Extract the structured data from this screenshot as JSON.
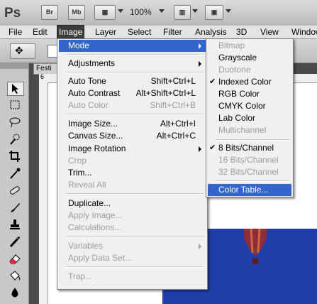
{
  "app": {
    "logo": "Ps",
    "bridge_button": "Br",
    "minibridge_button": "Mb",
    "zoom": "100%"
  },
  "menubar": [
    "File",
    "Edit",
    "Image",
    "Layer",
    "Select",
    "Filter",
    "Analysis",
    "3D",
    "View",
    "Window"
  ],
  "document": {
    "tab_title": "Festi",
    "ruler_mark": "6",
    "ruler_mark_top": "1"
  },
  "image_menu": {
    "items": [
      {
        "label": "Mode",
        "shortcut": "",
        "submenu": true,
        "disabled": false,
        "highlight": true
      },
      {
        "label": "Adjustments",
        "shortcut": "",
        "submenu": true,
        "disabled": false
      },
      {
        "label": "Auto Tone",
        "shortcut": "Shift+Ctrl+L",
        "disabled": false
      },
      {
        "label": "Auto Contrast",
        "shortcut": "Alt+Shift+Ctrl+L",
        "disabled": false
      },
      {
        "label": "Auto Color",
        "shortcut": "Shift+Ctrl+B",
        "disabled": true
      },
      {
        "label": "Image Size...",
        "shortcut": "Alt+Ctrl+I",
        "disabled": false
      },
      {
        "label": "Canvas Size...",
        "shortcut": "Alt+Ctrl+C",
        "disabled": false
      },
      {
        "label": "Image Rotation",
        "shortcut": "",
        "submenu": true,
        "disabled": false
      },
      {
        "label": "Crop",
        "shortcut": "",
        "disabled": true
      },
      {
        "label": "Trim...",
        "shortcut": "",
        "disabled": false
      },
      {
        "label": "Reveal All",
        "shortcut": "",
        "disabled": true
      },
      {
        "label": "Duplicate...",
        "shortcut": "",
        "disabled": false
      },
      {
        "label": "Apply Image...",
        "shortcut": "",
        "disabled": true
      },
      {
        "label": "Calculations...",
        "shortcut": "",
        "disabled": true
      },
      {
        "label": "Variables",
        "shortcut": "",
        "submenu": true,
        "disabled": true
      },
      {
        "label": "Apply Data Set...",
        "shortcut": "",
        "disabled": true
      },
      {
        "label": "Trap...",
        "shortcut": "",
        "disabled": true
      }
    ]
  },
  "mode_menu": {
    "items": [
      {
        "label": "Bitmap",
        "disabled": true,
        "checked": false
      },
      {
        "label": "Grayscale",
        "disabled": false,
        "checked": false
      },
      {
        "label": "Duotone",
        "disabled": true,
        "checked": false
      },
      {
        "label": "Indexed Color",
        "disabled": false,
        "checked": true
      },
      {
        "label": "RGB Color",
        "disabled": false,
        "checked": false
      },
      {
        "label": "CMYK Color",
        "disabled": false,
        "checked": false
      },
      {
        "label": "Lab Color",
        "disabled": false,
        "checked": false
      },
      {
        "label": "Multichannel",
        "disabled": true,
        "checked": false
      },
      {
        "label": "8 Bits/Channel",
        "disabled": false,
        "checked": true
      },
      {
        "label": "16 Bits/Channel",
        "disabled": true,
        "checked": false
      },
      {
        "label": "32 Bits/Channel",
        "disabled": true,
        "checked": false
      },
      {
        "label": "Color Table...",
        "disabled": false,
        "checked": false,
        "highlight": true
      }
    ],
    "check_glyph": "✔"
  },
  "colors": {
    "highlight": "#3366cc",
    "canvas_blue": "#1f3ea8"
  }
}
